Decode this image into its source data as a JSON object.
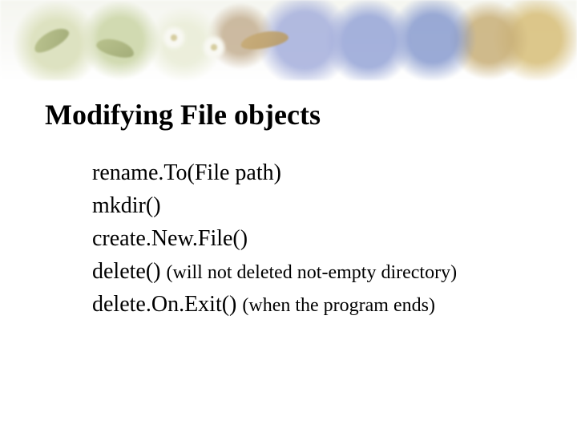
{
  "slide": {
    "title": "Modifying File objects",
    "lines": [
      {
        "main": "rename.To(File path)",
        "note": ""
      },
      {
        "main": " mkdir()",
        "note": ""
      },
      {
        "main": " create.New.File()",
        "note": ""
      },
      {
        "main": "delete()    ",
        "note": "(will not deleted not-empty directory)"
      },
      {
        "main": "delete.On.Exit()   ",
        "note": "(when the program ends)"
      }
    ]
  }
}
